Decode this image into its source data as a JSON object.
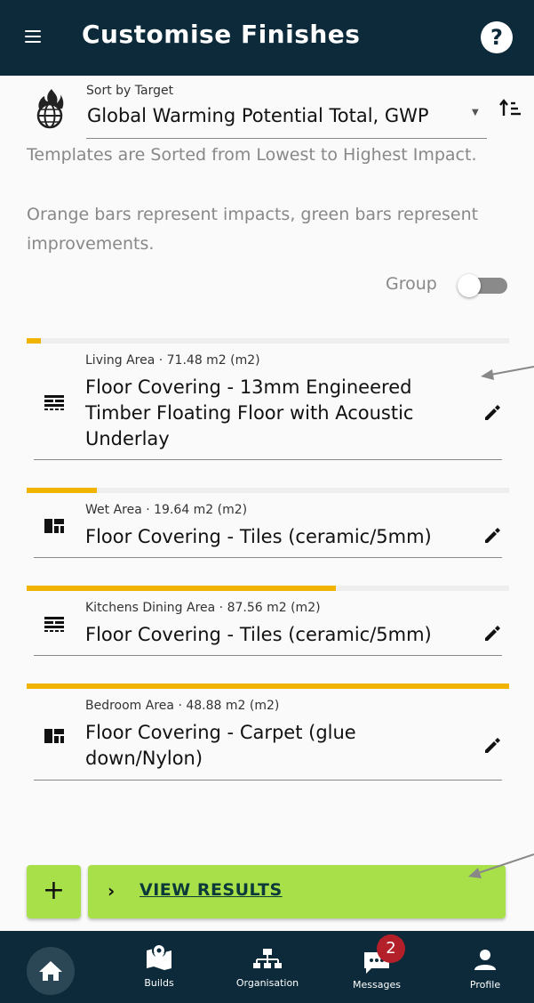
{
  "header": {
    "title": "Customise Finishes",
    "help_glyph": "?"
  },
  "sort": {
    "label": "Sort by Target",
    "value": "Global Warming Potential Total, GWP",
    "icon": "globe-flame-icon"
  },
  "description": {
    "line1": "Templates are Sorted from Lowest to Highest Impact.",
    "line2": "Orange bars represent impacts, green bars represent improvements."
  },
  "group": {
    "label": "Group",
    "enabled": false
  },
  "items": [
    {
      "subtitle": "Living Area · 71.48 m2 (m2)",
      "title": "Floor Covering - 13mm Engineered Timber Floating Floor with Acoustic Underlay",
      "impact_fraction": 0.03,
      "icon": "floorboards-icon"
    },
    {
      "subtitle": "Wet Area · 19.64 m2 (m2)",
      "title": "Floor Covering - Tiles (ceramic/5mm)",
      "impact_fraction": 0.145,
      "icon": "tiles-icon"
    },
    {
      "subtitle": "Kitchens Dining Area · 87.56 m2 (m2)",
      "title": "Floor Covering - Tiles (ceramic/5mm)",
      "impact_fraction": 0.64,
      "icon": "floorboards-icon"
    },
    {
      "subtitle": "Bedroom Area · 48.88 m2 (m2)",
      "title": "Floor Covering - Carpet (glue down/Nylon)",
      "impact_fraction": 1.0,
      "icon": "tiles-icon"
    }
  ],
  "actions": {
    "add_glyph": "+",
    "results_label": "VIEW RESULTS",
    "chevron": "›"
  },
  "nav": {
    "builds": "Builds",
    "organisation": "Organisation",
    "messages": "Messages",
    "messages_badge": "2",
    "profile": "Profile"
  },
  "colors": {
    "header_bg": "#0c2a3a",
    "impact_bar": "#f0b400",
    "action_green": "#a8e04a",
    "badge_red": "#b3202a"
  }
}
